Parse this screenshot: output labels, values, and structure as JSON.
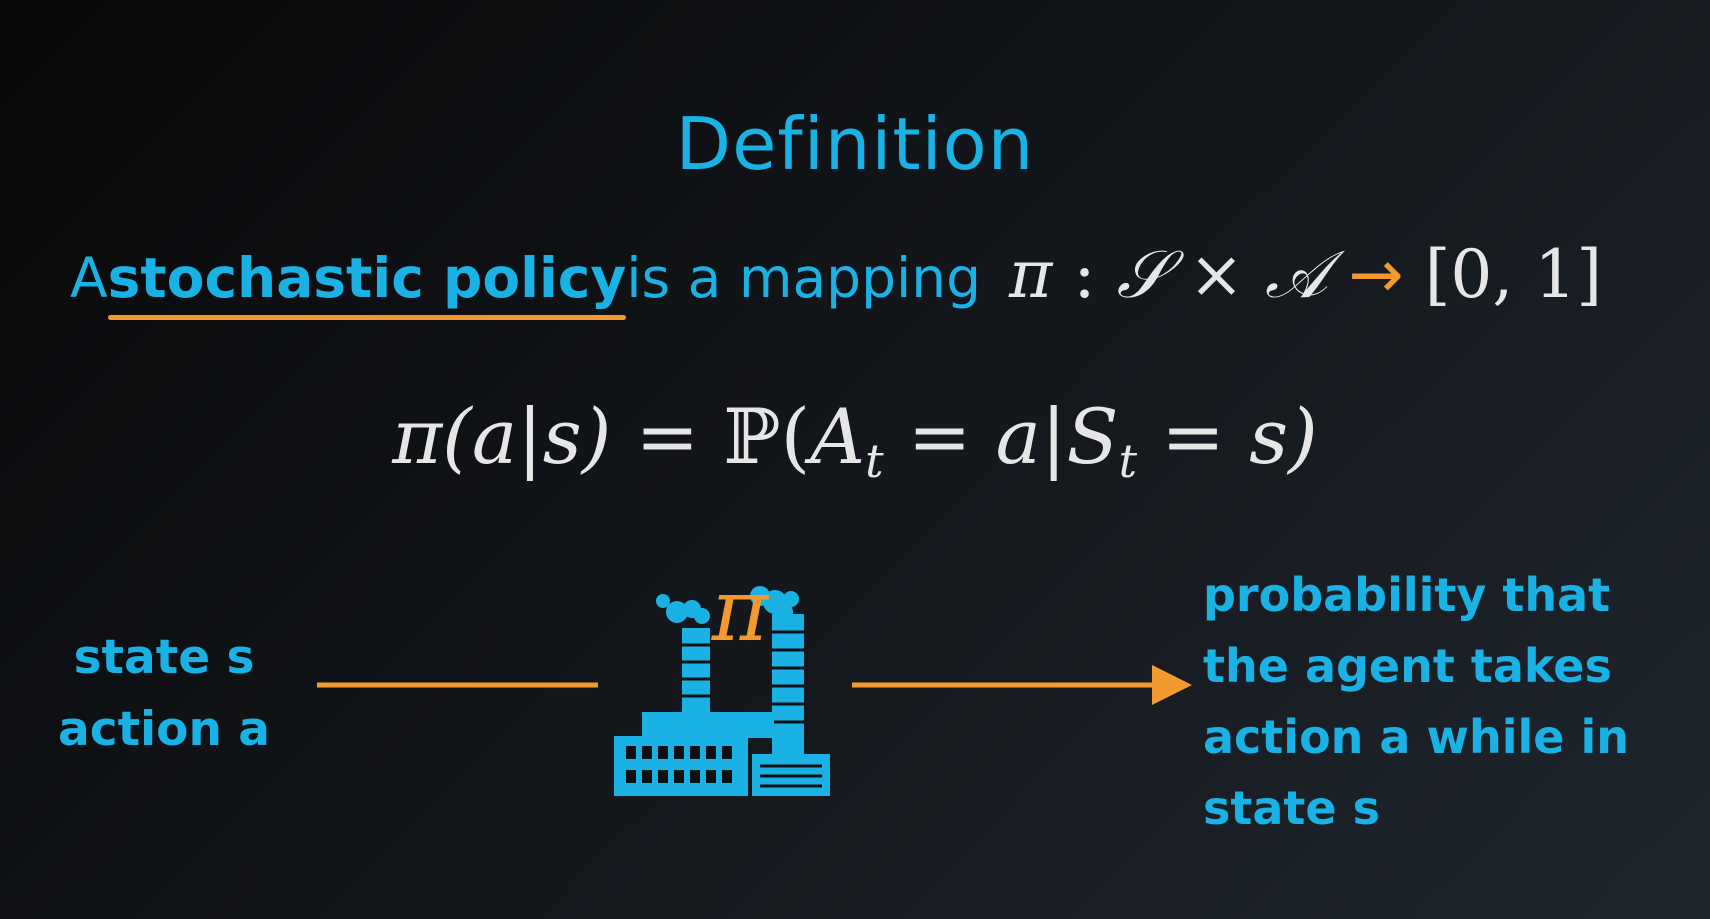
{
  "title": "Definition",
  "definition": {
    "prefix": "A ",
    "term": "stochastic policy",
    "suffix": " is a mapping",
    "math": {
      "pi": "π",
      "colon": " : ",
      "state_space": "𝒮",
      "times": " × ",
      "action_space": "𝒜",
      "arrow": " → ",
      "range": "[0, 1]"
    }
  },
  "equation": {
    "lhs": "π(a|s) = ",
    "prob": "ℙ(",
    "A": "A",
    "t1": "t",
    "mid": " = a|",
    "S": "S",
    "t2": "t",
    "rhs": " = s)"
  },
  "inputs": {
    "line1": "state s",
    "line2": "action a"
  },
  "output": {
    "line1": "probability that",
    "line2": "the agent takes",
    "line3": "action a while in",
    "line4": "state s"
  },
  "factory": {
    "symbol": "π"
  },
  "colors": {
    "accent_blue": "#1ab2e5",
    "accent_orange": "#f29a30",
    "math_text": "#e6e6e6"
  },
  "icons": {
    "factory": "factory-icon",
    "arrow": "arrow-right-icon"
  }
}
